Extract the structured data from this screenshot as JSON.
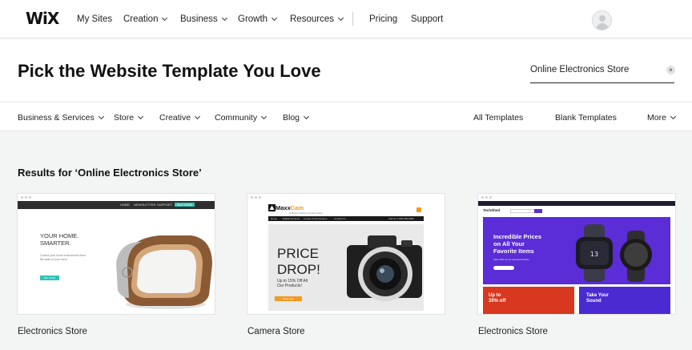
{
  "brand": {
    "logo_text": "WiX"
  },
  "topnav": {
    "items": [
      {
        "label": "My Sites",
        "has_dropdown": false
      },
      {
        "label": "Creation",
        "has_dropdown": true
      },
      {
        "label": "Business",
        "has_dropdown": true
      },
      {
        "label": "Growth",
        "has_dropdown": true
      },
      {
        "label": "Resources",
        "has_dropdown": true
      },
      {
        "label": "Pricing",
        "has_dropdown": false
      },
      {
        "label": "Support",
        "has_dropdown": false
      }
    ]
  },
  "hero": {
    "title": "Pick the Website Template You Love",
    "search_value": "Online Electronics Store",
    "clear_symbol": "×"
  },
  "categories": {
    "left": [
      {
        "label": "Business & Services"
      },
      {
        "label": "Store"
      },
      {
        "label": "Creative"
      },
      {
        "label": "Community"
      },
      {
        "label": "Blog"
      }
    ],
    "right": [
      {
        "label": "All Templates"
      },
      {
        "label": "Blank Templates"
      },
      {
        "label": "More"
      }
    ]
  },
  "results": {
    "heading": "Results for ‘Online Electronics Store’",
    "cards": [
      {
        "name": "Electronics Store",
        "preview": {
          "nav": [
            "HOME",
            "NEWSLETTER",
            "SUPPORT",
            "BUY NOW"
          ],
          "headline_line1": "YOUR HOME.",
          "headline_line2": "SMARTER.",
          "subtext": "Control your home environment from the palm of your hand",
          "link": "Learn More",
          "button": "BUY NOW"
        }
      },
      {
        "name": "Camera Store",
        "preview": {
          "logo_a": "Maxx",
          "logo_b": "Cam",
          "tagline": "A Picture Perfect Camera Store",
          "nav": [
            "Home",
            "Digital Cameras",
            "Lenses & Accessories",
            "Contact Us"
          ],
          "phone": "Call Us 1-800-000-0000",
          "headline_line1": "PRICE",
          "headline_line2": "DROP!",
          "offer_line1": "Up to 15% Off All",
          "offer_line2": "Our Products!",
          "button": "Shop Now"
        }
      },
      {
        "name": "Electronics Store",
        "preview": {
          "brand": "TechShed",
          "headline_line1": "Incredible Prices",
          "headline_line2": "on All Your",
          "headline_line3": "Favorite Items",
          "subtext": "Take 30% off our selected brands",
          "tile1_line1": "Up to",
          "tile1_line2": "30% off",
          "tile2_line1": "Take Your",
          "tile2_line2": "Sound"
        }
      }
    ]
  },
  "colors": {
    "accent_teal": "#2ec4b6",
    "accent_orange": "#f29a1f",
    "accent_purple": "#5a2dd6",
    "accent_red": "#d7381f"
  }
}
